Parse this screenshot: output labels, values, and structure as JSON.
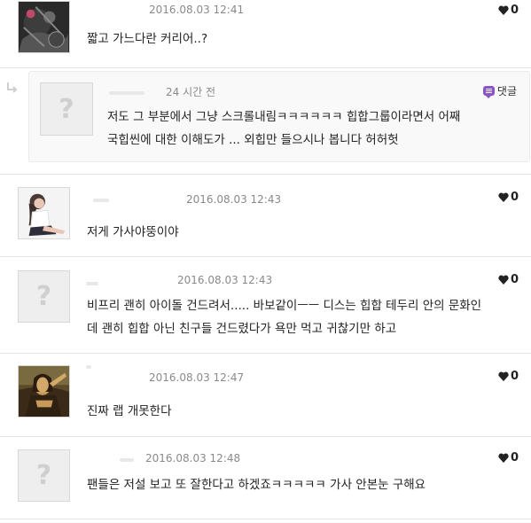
{
  "comments": [
    {
      "date": "2016.08.03 12:41",
      "likes": "0",
      "text": [
        "짧고 가느다란 커리어..?"
      ],
      "avatar": "album-cover-avatar"
    },
    {
      "date": "2016.08.03 12:43",
      "likes": "0",
      "text": [
        "저게 가사야뚱이야"
      ],
      "avatar": "person-photo-avatar"
    },
    {
      "date": "2016.08.03 12:43",
      "likes": "0",
      "text": [
        "비프리 괜히 아이돌 건드려서..... 바보같이ㅡㅡ 디스는 힙합 테두리 안의 문화인",
        "데 괜히 힙합 아닌 친구들 건드렸다가 욕만 먹고 귀찮기만 하고"
      ],
      "avatar": "placeholder"
    },
    {
      "date": "2016.08.03 12:47",
      "likes": "0",
      "text": [
        "진짜 랩 개못한다"
      ],
      "avatar": "painting-avatar"
    },
    {
      "date": "2016.08.03 12:48",
      "likes": "0",
      "text": [
        "팬들은 저설 보고 또 잘한다고 하겠죠ㅋㅋㅋㅋㅋ 가사 안본눈 구해요"
      ],
      "avatar": "placeholder"
    }
  ],
  "reply": {
    "time": "24 시간 전",
    "reply_label": "댓글",
    "text": [
      "저도 그 부분에서 그냥 스크롤내림ㅋㅋㅋㅋㅋㅋ 힙합그룹이라면서 어째",
      "국힙씬에 대한 이해도가 ... 외힙만 들으시나 봅니다 허허헛"
    ]
  },
  "avatar_placeholder_glyph": "?",
  "colors": {
    "heart": "#222222",
    "reply_badge": "#8a54c8"
  }
}
